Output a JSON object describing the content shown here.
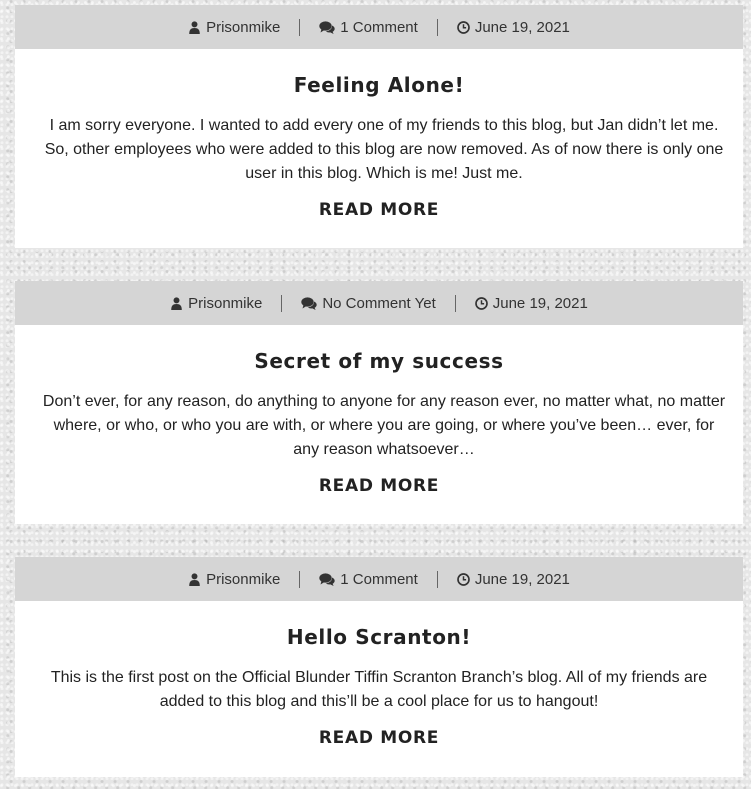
{
  "posts": [
    {
      "author": "Prisonmike",
      "comments": "1 Comment",
      "date": "June 19, 2021",
      "title": "Feeling Alone!",
      "excerpt": "I am sorry everyone. I wanted to add every one of my friends to this blog, but Jan didn’t let me. So, other employees who were added to this blog are now removed. As of now there is only one user in this blog. Which is me! Just me.",
      "read_more": "READ MORE"
    },
    {
      "author": "Prisonmike",
      "comments": "No Comment Yet",
      "date": "June 19, 2021",
      "title": "Secret of my success",
      "excerpt": "Don’t ever, for any reason, do anything to anyone for any reason ever, no matter what, no matter where, or who, or who you are with, or where you are going, or where you’ve been… ever, for any reason whatsoever…",
      "read_more": "READ MORE"
    },
    {
      "author": "Prisonmike",
      "comments": "1 Comment",
      "date": "June 19, 2021",
      "title": "Hello Scranton!",
      "excerpt": "This is the first post on the Official Blunder Tiffin Scranton Branch’s blog. All of my friends are added to this blog and this’ll be a cool place for us to hangout!",
      "read_more": "READ MORE"
    }
  ],
  "icons": {
    "author": "user-icon",
    "comments": "comments-icon",
    "date": "clock-icon"
  }
}
